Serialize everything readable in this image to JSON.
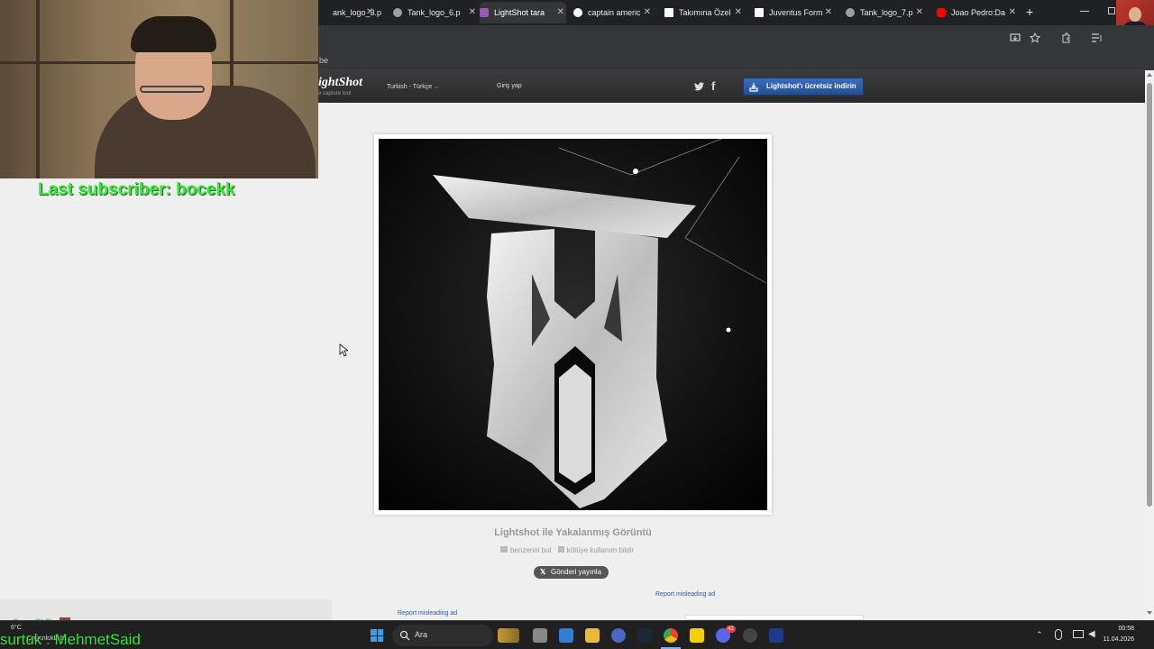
{
  "tabs": [
    {
      "label": "ank_logo_3.p",
      "active": false
    },
    {
      "label": "Tank_logo_6.p",
      "active": false
    },
    {
      "label": "LightShot tara",
      "active": true
    },
    {
      "label": "captain americ",
      "active": false
    },
    {
      "label": "Takımına Özel",
      "active": false
    },
    {
      "label": "Juventus Form",
      "active": false
    },
    {
      "label": "Tank_logo_7.p",
      "active": false
    },
    {
      "label": "Joao Pedro:Da",
      "active": false
    }
  ],
  "tab_close": "✕",
  "new_tab": "+",
  "bookmark_fragment": "be",
  "lightshot": {
    "logo": "ightShot",
    "logo_sub": "e capture tool",
    "language": "Turkish - Türkçe",
    "login": "Giriş yap",
    "twitter": "twitter-icon",
    "facebook": "facebook-icon",
    "download_button": "Lightshot'ı ücretsiz indirin",
    "caption": "Lightshot ile Yakalanmış Görüntü",
    "find_similar": "benzerini bul",
    "report_abuse": "kötüye kullanım bildir",
    "tweet_button": "Gönderi yayınla",
    "report_ad_1": "Report misleading ad",
    "report_ad_2": "Report misleading ad"
  },
  "overlay": {
    "last_subscriber": "Last subscriber: bocekk",
    "bottom_text": "surtuk : MehmetSaid",
    "chat_user": "GamaSLR :"
  },
  "taskbar": {
    "search": "Ara",
    "weather_temp": "6°C",
    "weather_text": "Çoğunlukla b...",
    "time": "00:58",
    "date": "11.04.2026",
    "discord_badge": "42"
  },
  "colors": {
    "accent_green": "#39e639",
    "lightshot_blue": "#2c5aa0",
    "chrome_dark": "#202124"
  }
}
